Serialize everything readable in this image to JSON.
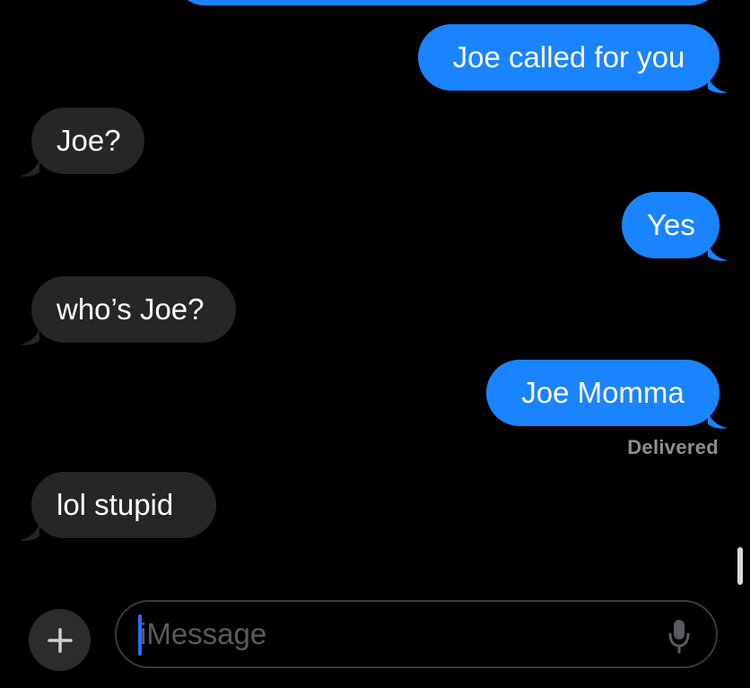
{
  "messages": [
    {
      "id": "m1",
      "direction": "sent",
      "text": ""
    },
    {
      "id": "m2",
      "direction": "sent",
      "text": "Joe called for you"
    },
    {
      "id": "m3",
      "direction": "received",
      "text": "Joe?"
    },
    {
      "id": "m4",
      "direction": "sent",
      "text": "Yes"
    },
    {
      "id": "m5",
      "direction": "received",
      "text": "who’s Joe?"
    },
    {
      "id": "m6",
      "direction": "sent",
      "text": "Joe Momma"
    },
    {
      "id": "m7",
      "direction": "received",
      "text": "lol stupid"
    }
  ],
  "status": {
    "delivered": "Delivered"
  },
  "composer": {
    "placeholder": "iMessage",
    "plus_icon": "plus-icon",
    "mic_icon": "microphone-icon"
  },
  "colors": {
    "sent_bubble": "#1a84ff",
    "received_bubble": "#262629",
    "background": "#000000",
    "status_text": "#8e8e93"
  }
}
